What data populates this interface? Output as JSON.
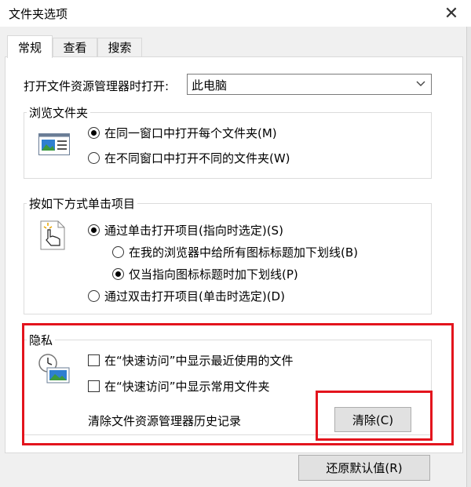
{
  "window": {
    "title": "文件夹选项"
  },
  "tabs": [
    {
      "label": "常规",
      "active": true
    },
    {
      "label": "查看",
      "active": false
    },
    {
      "label": "搜索",
      "active": false
    }
  ],
  "open_with": {
    "label": "打开文件资源管理器时打开:",
    "value": "此电脑"
  },
  "browse_folders": {
    "title": "浏览文件夹",
    "options": [
      {
        "label": "在同一窗口中打开每个文件夹(M)",
        "selected": true
      },
      {
        "label": "在不同窗口中打开不同的文件夹(W)",
        "selected": false
      }
    ]
  },
  "click_items": {
    "title": "按如下方式单击项目",
    "options": [
      {
        "label": "通过单击打开项目(指向时选定)(S)",
        "selected": true
      },
      {
        "label": "在我的浏览器中给所有图标标题加下划线(B)",
        "selected": false
      },
      {
        "label": "仅当指向图标标题时加下划线(P)",
        "selected": true
      },
      {
        "label": "通过双击打开项目(单击时选定)(D)",
        "selected": false
      }
    ]
  },
  "privacy": {
    "title": "隐私",
    "checks": [
      {
        "label": "在“快速访问”中显示最近使用的文件",
        "checked": false
      },
      {
        "label": "在“快速访问”中显示常用文件夹",
        "checked": false
      }
    ],
    "clear_label": "清除文件资源管理器历史记录",
    "clear_button": "清除(C)"
  },
  "restore_button": "还原默认值(R)",
  "colors": {
    "highlight": "#e3141d",
    "dialog_bg": "#f0f0f0"
  }
}
